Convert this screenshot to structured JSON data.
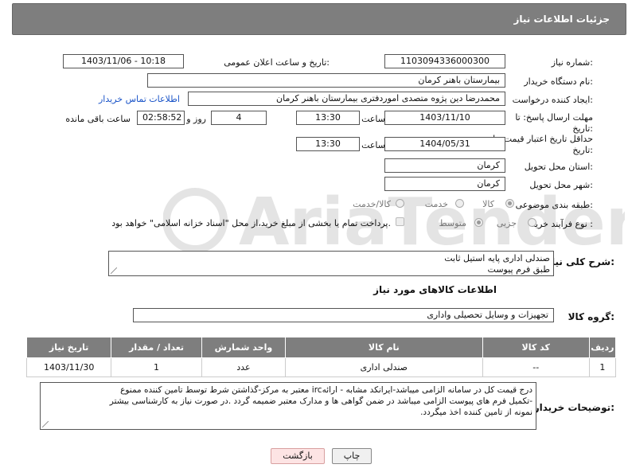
{
  "header": {
    "title": "جزئیات اطلاعات نیاز"
  },
  "fields": {
    "need_number_label": "شماره نیاز:",
    "need_number": "1103094336000300",
    "announce_label": "تاریخ و ساعت اعلان عمومی:",
    "announce_value": "1403/11/06 - 10:18",
    "buyer_label": "نام دستگاه خریدار:",
    "buyer_value": "بیمارستان باهنر کرمان",
    "creator_label": "ایجاد کننده درخواست:",
    "creator_value": "محمدرضا  دین پژوه متصدی اموردفتری بیمارستان باهنر کرمان",
    "contact_link": "اطلاعات تماس خریدار",
    "deadline_label_1": "مهلت ارسال پاسخ: تا",
    "deadline_label_2": "تاریخ:",
    "deadline_date": "1403/11/10",
    "time_label": "ساعت",
    "deadline_time": "13:30",
    "days_value": "4",
    "days_label": "روز و",
    "remaining_time": "02:58:52",
    "remaining_label": "ساعت باقی مانده",
    "validity_label_1": "حداقل تاریخ اعتبار قیمت: تا",
    "validity_label_2": "تاریخ:",
    "validity_date": "1404/05/31",
    "validity_time": "13:30",
    "province_label": "استان محل تحویل:",
    "province_value": "کرمان",
    "city_label": "شهر محل تحویل:",
    "city_value": "کرمان",
    "category_label": "طبقه بندی موضوعی:",
    "category_options": [
      "کالا",
      "خدمت",
      "کالا/خدمت"
    ],
    "process_label": "نوع فرآیند خرید :",
    "process_options": [
      "جزیی",
      "متوسط"
    ],
    "payment_note": "پرداخت تمام یا بخشی از مبلغ خرید،از محل \"اسناد خزانه اسلامی\" خواهد بود."
  },
  "description": {
    "label": "شرح کلی نیاز:",
    "line1": "صندلی اداری پایه استیل ثابت",
    "line2": "طبق فرم پیوست"
  },
  "goods_info_title": "اطلاعات کالاهای مورد نیاز",
  "goods_group": {
    "label": "گروه کالا:",
    "value": "تجهیزات و وسایل تحصیلی واداری"
  },
  "table": {
    "headers": [
      "ردیف",
      "کد کالا",
      "نام کالا",
      "واحد شمارش",
      "تعداد / مقدار",
      "تاریخ نیاز"
    ],
    "rows": [
      [
        "1",
        "--",
        "صندلی اداری",
        "عدد",
        "1",
        "1403/11/30"
      ]
    ]
  },
  "buyer_notes": {
    "label": "توضیحات خریدار:",
    "line1": "درج قیمت کل در سامانه الزامی میباشد-ایرانکد مشابه - ارائهirc معتبر به مرکز-گذاشتن شرط توسط تامین کننده ممنوع",
    "line2": "-تکمیل فرم های پیوست الزامی میباشد در ضمن گواهی ها و مدارک معتبر ضمیمه گردد .در صورت نیاز به کارشناسی بیشتر",
    "line3": "نمونه از تامین کننده اخذ میگردد."
  },
  "buttons": {
    "print": "چاپ",
    "back": "بازگشت"
  },
  "watermark_text": "AriaTender.neT"
}
